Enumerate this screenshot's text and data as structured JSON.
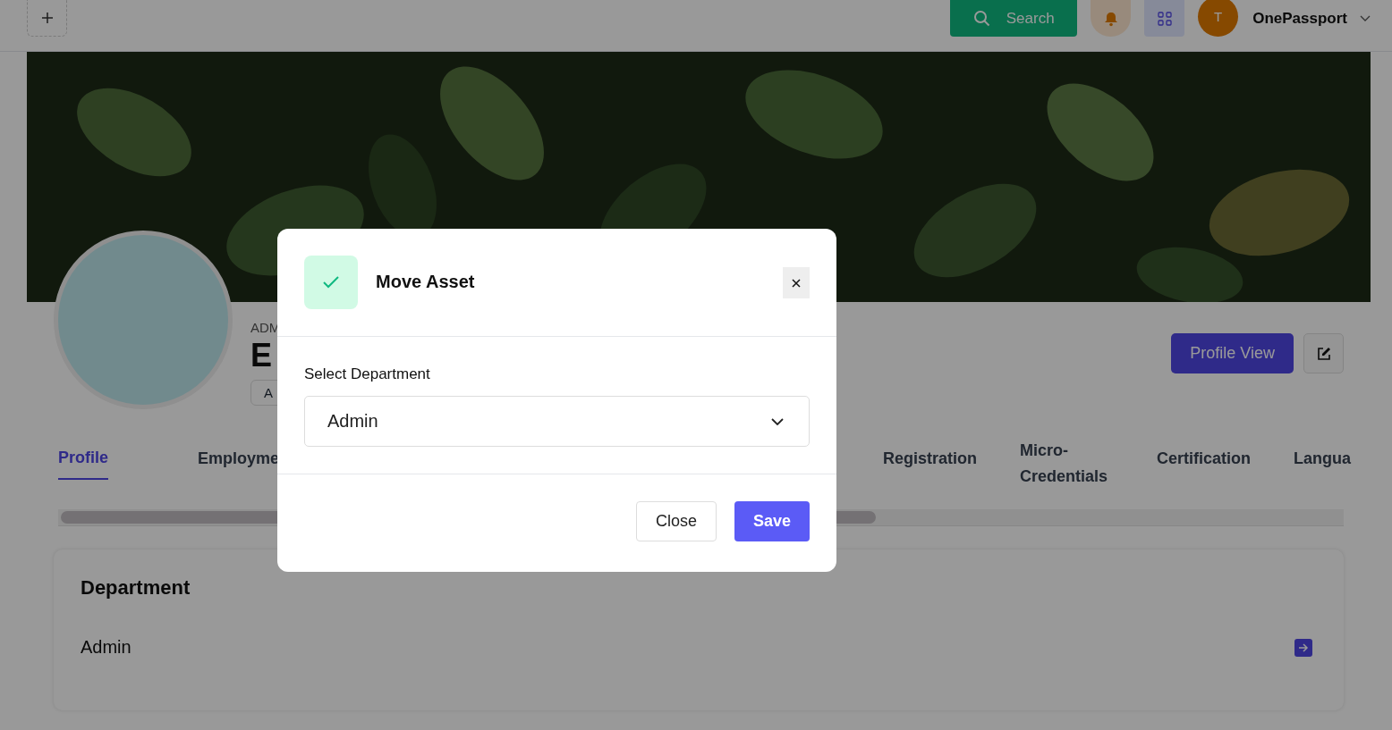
{
  "header": {
    "search_button": "Search",
    "user": {
      "initial": "T",
      "name": "OnePassport"
    }
  },
  "profile": {
    "role": "ADM",
    "name": "E",
    "badge": "A",
    "view_button": "Profile View"
  },
  "tabs": [
    {
      "label": "Profile",
      "selected": true
    },
    {
      "label": "Employme",
      "selected": false
    },
    {
      "label": "Registration",
      "selected": false
    },
    {
      "label": "Micro-Credentials",
      "selected": false
    },
    {
      "label": "Certification",
      "selected": false
    },
    {
      "label": "Langua",
      "selected": false
    }
  ],
  "department_card": {
    "title": "Department",
    "value": "Admin"
  },
  "modal": {
    "title": "Move Asset",
    "field_label": "Select Department",
    "selected_value": "Admin",
    "buttons": [
      {
        "label": "Close",
        "kind": "secondary"
      },
      {
        "label": "Save",
        "kind": "primary"
      }
    ]
  }
}
